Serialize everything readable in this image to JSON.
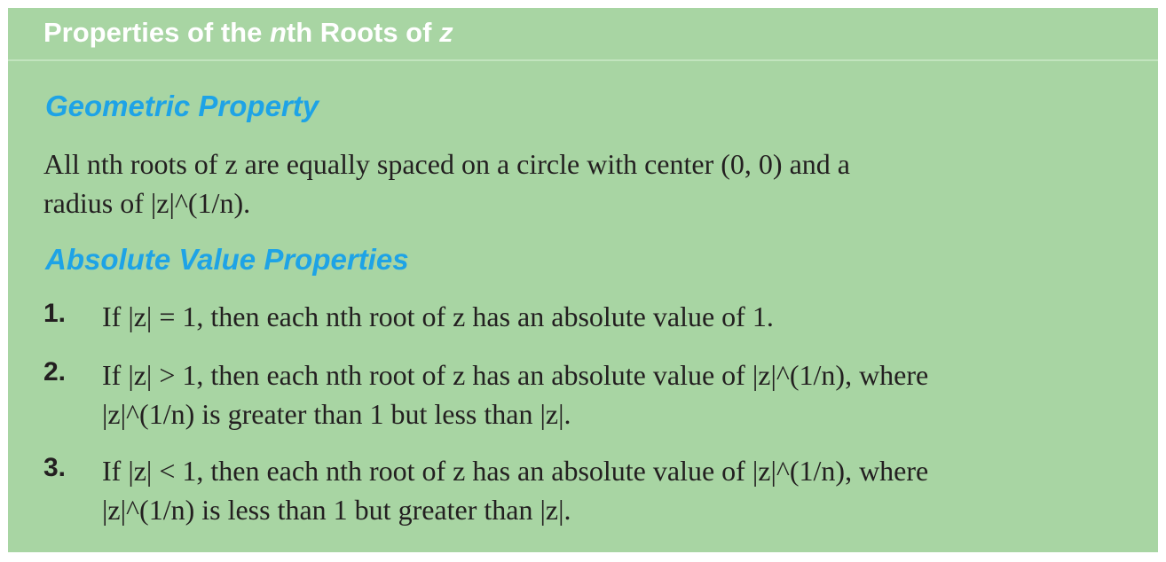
{
  "title": {
    "prefix": "Properties of the ",
    "n": "n",
    "middle": "th Roots of ",
    "z": "z"
  },
  "geometric": {
    "heading": "Geometric Property",
    "line1": "All nth roots of z are equally spaced on a circle with center (0, 0) and a",
    "line2": "radius of |z|^(1/n)."
  },
  "absolute": {
    "heading": "Absolute Value Properties",
    "items": [
      {
        "number": "1.",
        "line1": "If |z| = 1, then each nth root of z has an absolute value of 1."
      },
      {
        "number": "2.",
        "line1": "If |z| > 1, then each nth root of z has an absolute value of |z|^(1/n), where",
        "line2": "|z|^(1/n) is greater than 1 but less than |z|."
      },
      {
        "number": "3.",
        "line1": "If |z| < 1, then each nth root of z has an absolute value of |z|^(1/n), where",
        "line2": "|z|^(1/n) is less than 1 but greater than |z|."
      }
    ]
  },
  "colors": {
    "background": "#a8d5a3",
    "title_text": "#ffffff",
    "heading_text": "#1ea3e6",
    "body_text": "#231f20"
  }
}
